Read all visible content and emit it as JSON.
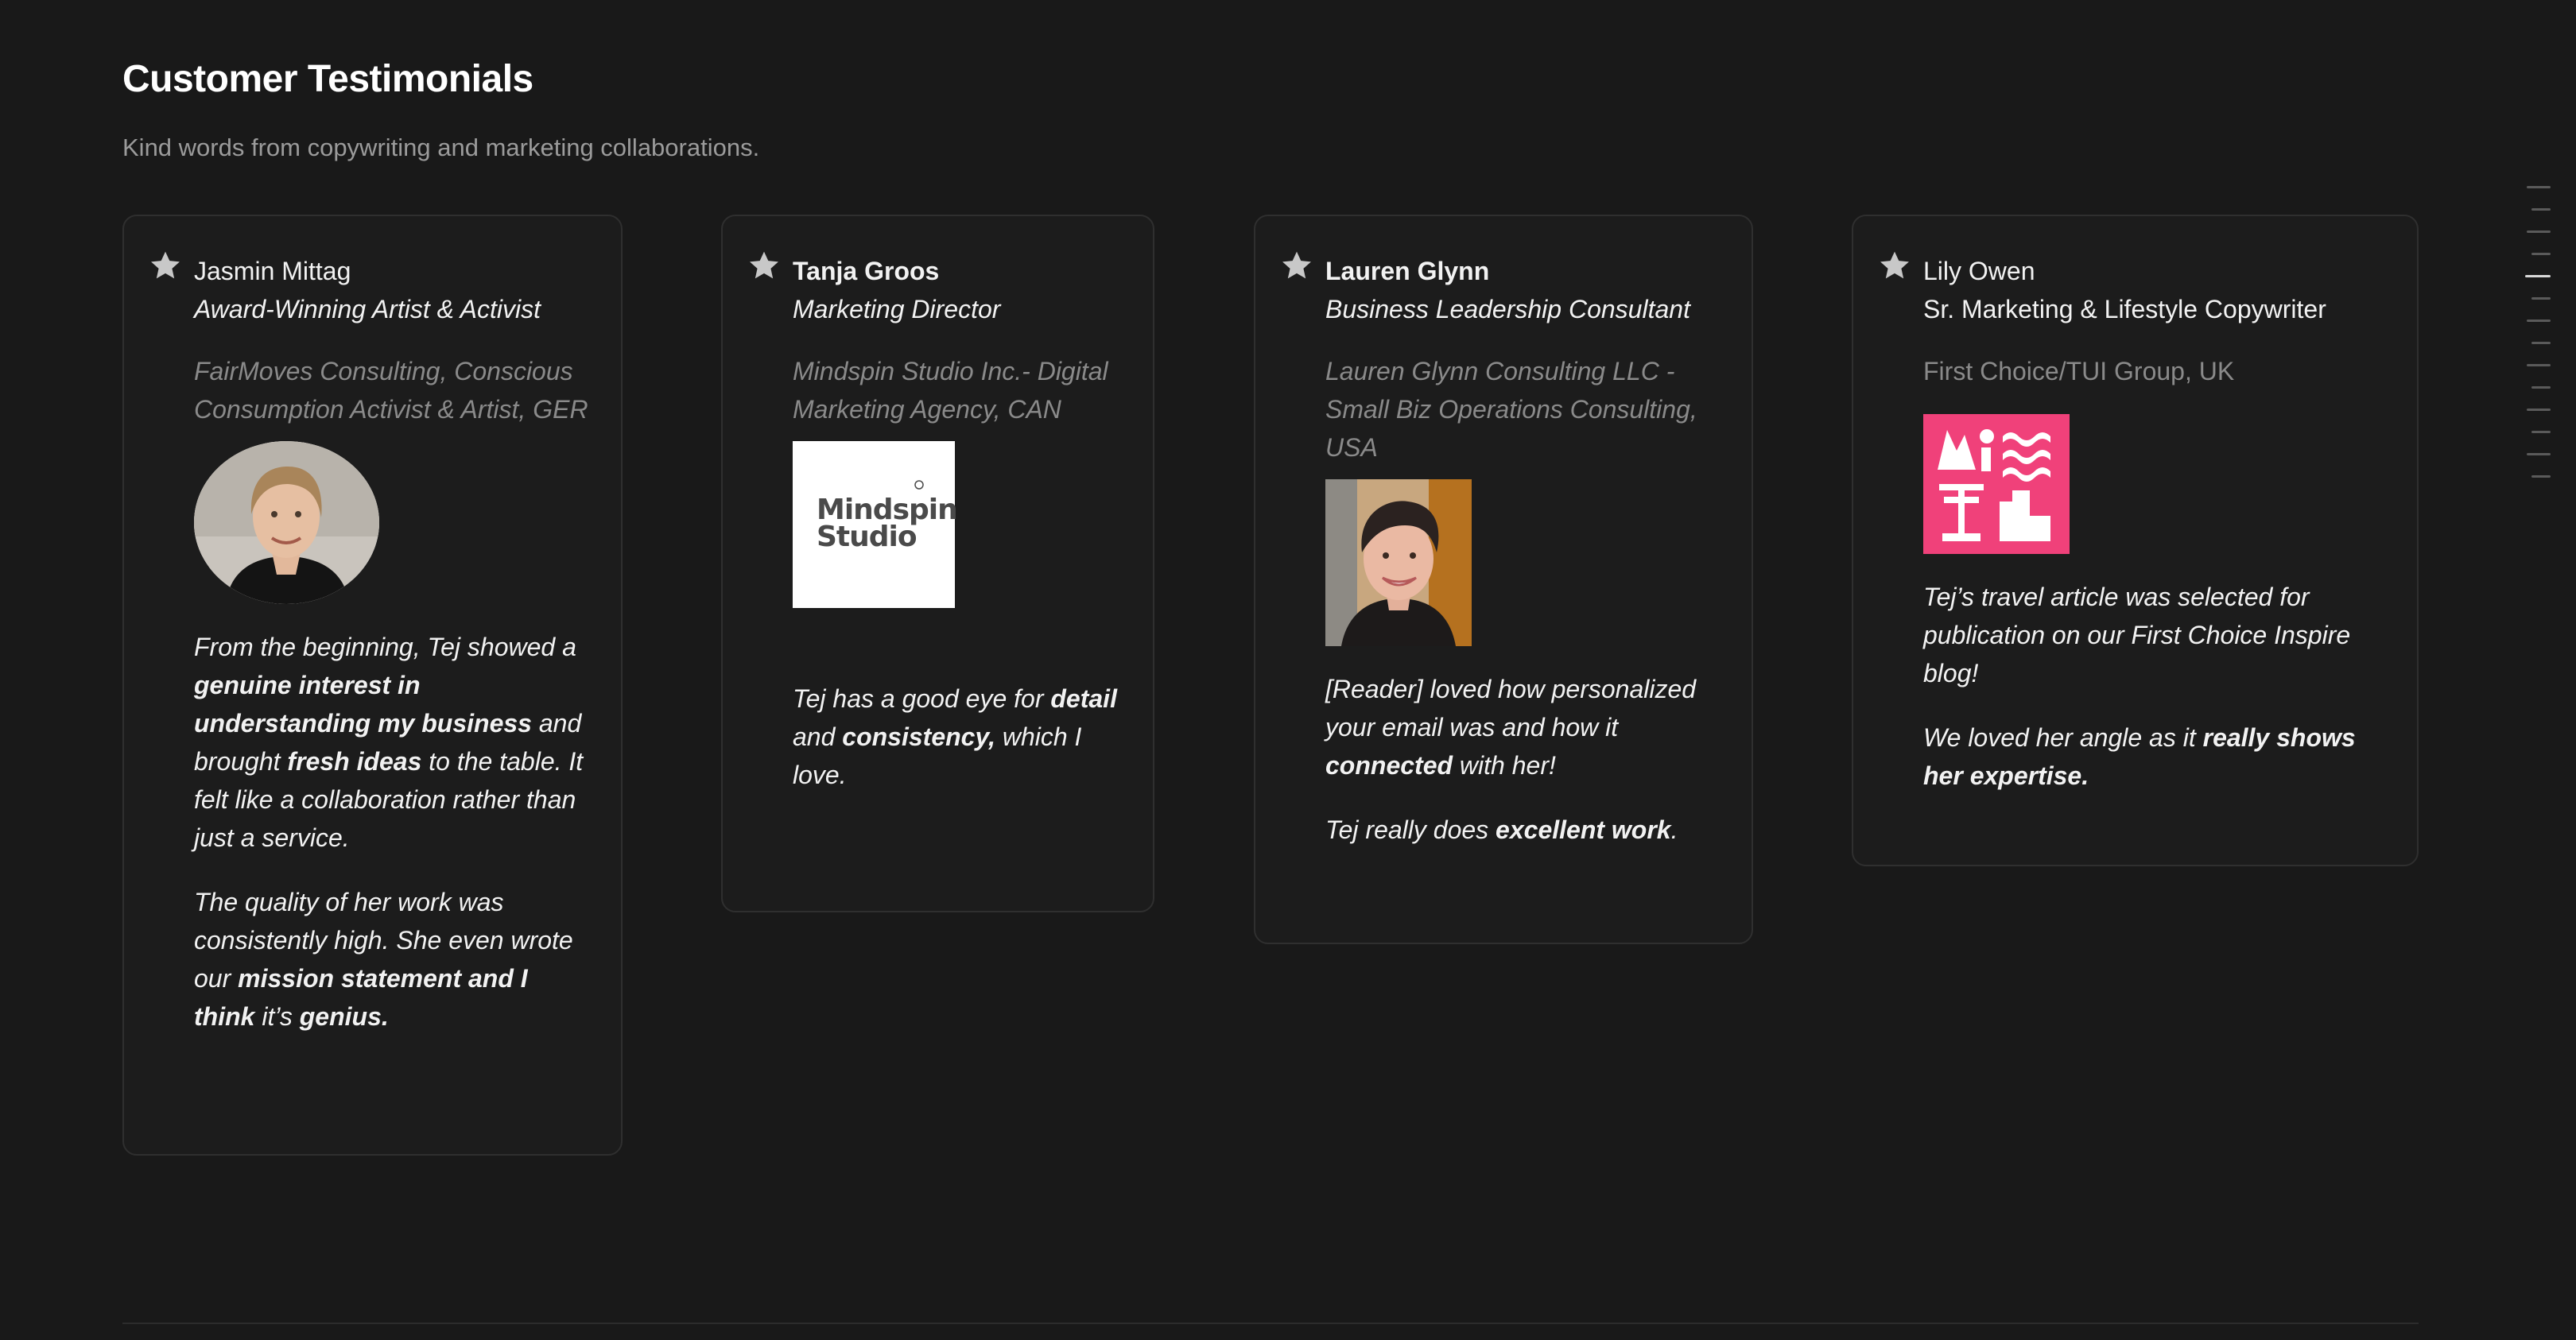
{
  "page": {
    "title": "Customer Testimonials",
    "subtitle": "Kind words from copywriting and marketing collaborations."
  },
  "testimonials": [
    {
      "name": "Jasmin Mittag",
      "role": "Award-Winning Artist & Activist",
      "company": "FairMoves Consulting, Conscious Consumption Activist & Artist, GER",
      "image": "portrait-photo",
      "quote": [
        [
          {
            "t": "From the beginning, Tej showed a "
          },
          {
            "t": "genuine interest in understanding my business",
            "b": true
          },
          {
            "t": " and brought "
          },
          {
            "t": "fresh ideas",
            "b": true
          },
          {
            "t": " to the table. It felt like a collaboration rather than just a service."
          }
        ],
        [
          {
            "t": "The quality of her work was consistently high. She even wrote our "
          },
          {
            "t": "mission statement and I think",
            "b": true
          },
          {
            "t": " it’s "
          },
          {
            "t": "genius.",
            "b": true
          }
        ]
      ]
    },
    {
      "name": "Tanja Groos",
      "role": "Marketing Director",
      "company": "Mindspin Studio Inc.- Digital Marketing Agency, CAN",
      "image": "company-logo",
      "logo_text": [
        "Mindspin",
        "Studio"
      ],
      "quote": [
        [
          {
            "t": "Tej has a good eye for "
          },
          {
            "t": "detail",
            "b": true
          },
          {
            "t": " and "
          },
          {
            "t": "consistency,",
            "b": true
          },
          {
            "t": " which I love."
          }
        ]
      ]
    },
    {
      "name": "Lauren Glynn",
      "role": "Business Leadership Consultant",
      "company": "Lauren Glynn Consulting LLC - Small Biz Operations Consulting, USA",
      "image": "portrait-photo",
      "quote": [
        [
          {
            "t": "[Reader] loved how personalized your email was and how it "
          },
          {
            "t": "connected",
            "b": true
          },
          {
            "t": " with her!"
          }
        ],
        [
          {
            "t": "Tej really does "
          },
          {
            "t": "excellent work",
            "b": true
          },
          {
            "t": "."
          }
        ]
      ]
    },
    {
      "name": "Lily Owen",
      "role": "Sr. Marketing & Lifestyle Copywriter",
      "company": "First Choice/TUI Group, UK",
      "image": "company-logo",
      "quote": [
        [
          {
            "t": "Tej’s travel article was selected for publication on our First Choice Inspire blog!"
          }
        ],
        [
          {
            "t": "We loved her angle as it "
          },
          {
            "t": "really shows her expertise.",
            "b": true
          }
        ]
      ]
    }
  ],
  "icons": {
    "card_marker": "star-icon",
    "scroll_index": "section-index-ticks"
  },
  "colors": {
    "background": "#191919",
    "card_border": "#2f2f2f",
    "text": "#f2f2f2",
    "muted": "#8a8a8a",
    "first_choice_brand": "#f0417a"
  }
}
